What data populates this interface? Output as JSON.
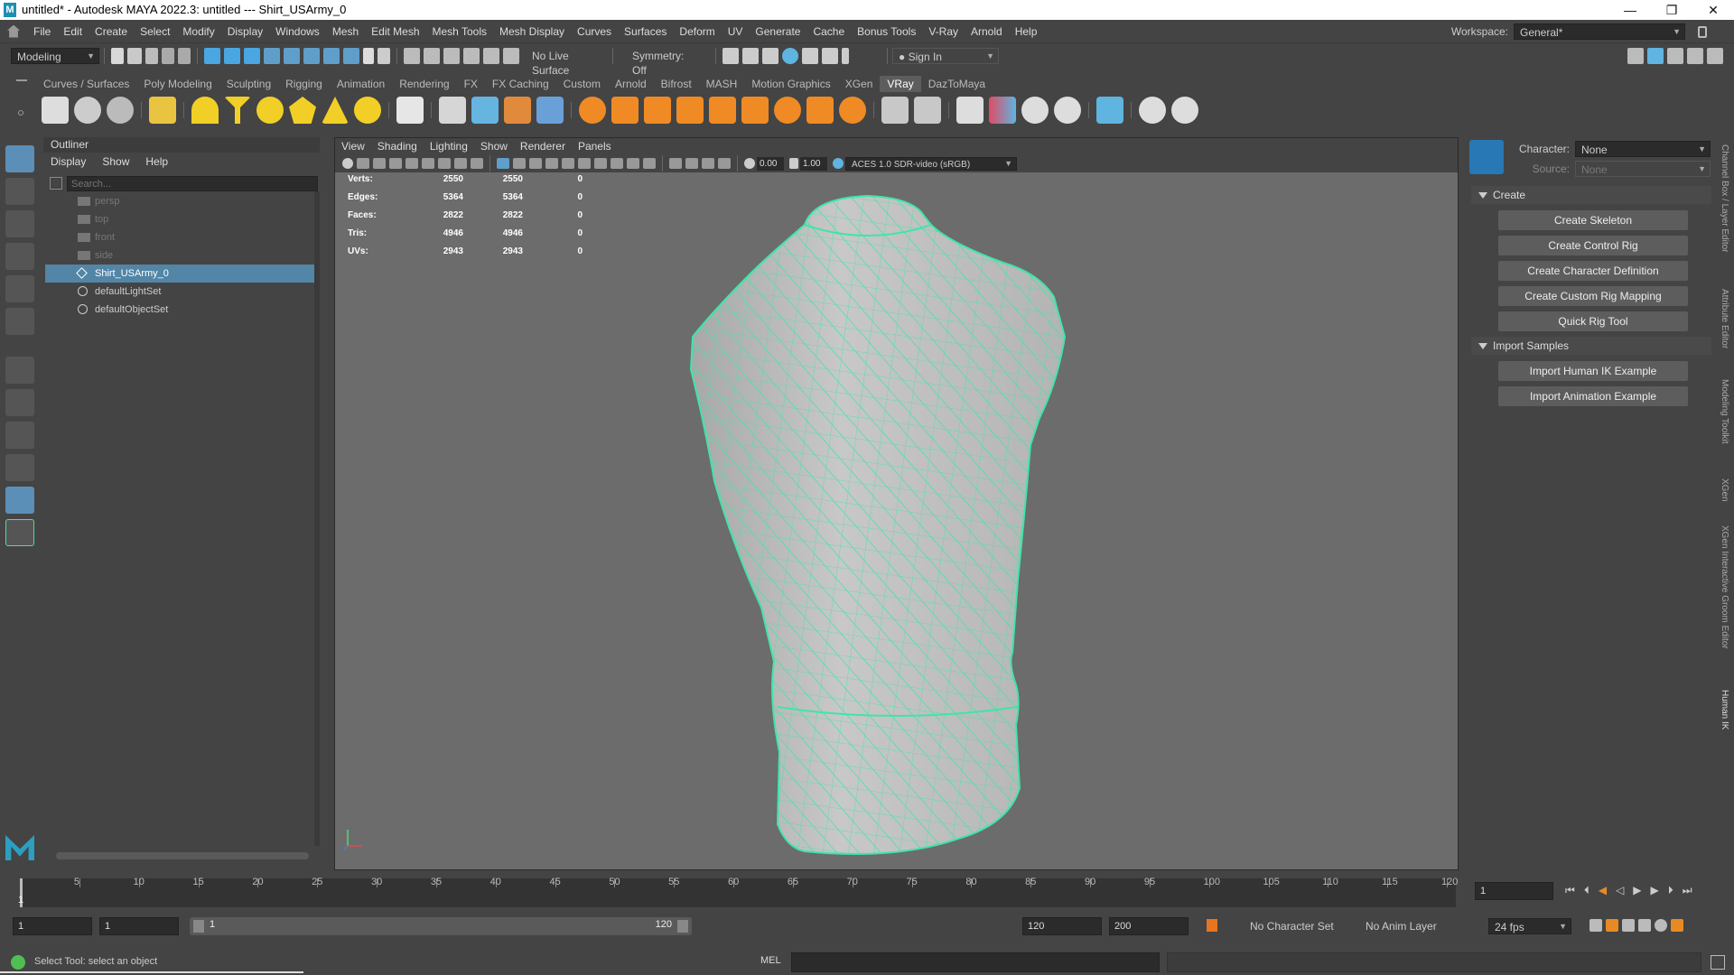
{
  "titlebar": {
    "title": "untitled* - Autodesk MAYA 2022.3: untitled  ---  Shirt_USArmy_0",
    "logo": "M",
    "min": "—",
    "max": "❐",
    "close": "✕"
  },
  "menubar": {
    "items": [
      "File",
      "Edit",
      "Create",
      "Select",
      "Modify",
      "Display",
      "Windows",
      "Mesh",
      "Edit Mesh",
      "Mesh Tools",
      "Mesh Display",
      "Curves",
      "Surfaces",
      "Deform",
      "UV",
      "Generate",
      "Cache",
      "Bonus Tools",
      "V-Ray",
      "Arnold",
      "Help"
    ],
    "workspace_label": "Workspace:",
    "workspace_value": "General*"
  },
  "statusline": {
    "mode": "Modeling",
    "live_surface": "No Live Surface",
    "symmetry": "Symmetry: Off",
    "sign_in": "Sign In"
  },
  "shelf": {
    "tabs": [
      "Curves / Surfaces",
      "Poly Modeling",
      "Sculpting",
      "Rigging",
      "Animation",
      "Rendering",
      "FX",
      "FX Caching",
      "Custom",
      "Arnold",
      "Bifrost",
      "MASH",
      "Motion Graphics",
      "XGen",
      "VRay",
      "DazToMaya"
    ],
    "active_tab": "VRay"
  },
  "outliner": {
    "title": "Outliner",
    "menu": [
      "Display",
      "Show",
      "Help"
    ],
    "search_placeholder": "Search...",
    "items": [
      {
        "label": "persp",
        "state": "dim",
        "icon": "camera-icon"
      },
      {
        "label": "top",
        "state": "dim",
        "icon": "camera-icon"
      },
      {
        "label": "front",
        "state": "dim",
        "icon": "camera-icon"
      },
      {
        "label": "side",
        "state": "dim",
        "icon": "camera-icon"
      },
      {
        "label": "Shirt_USArmy_0",
        "state": "selected",
        "icon": "mesh-icon"
      },
      {
        "label": "defaultLightSet",
        "state": "normal",
        "icon": "set-icon"
      },
      {
        "label": "defaultObjectSet",
        "state": "normal",
        "icon": "set-icon"
      }
    ]
  },
  "viewport": {
    "menu": [
      "View",
      "Shading",
      "Lighting",
      "Show",
      "Renderer",
      "Panels"
    ],
    "exposure": "0.00",
    "gamma": "1.00",
    "color_space": "ACES 1.0 SDR-video (sRGB)",
    "hud": [
      {
        "label": "Verts:",
        "a": "2550",
        "b": "2550",
        "c": "0"
      },
      {
        "label": "Edges:",
        "a": "5364",
        "b": "5364",
        "c": "0"
      },
      {
        "label": "Faces:",
        "a": "2822",
        "b": "2822",
        "c": "0"
      },
      {
        "label": "Tris:",
        "a": "4946",
        "b": "4946",
        "c": "0"
      },
      {
        "label": "UVs:",
        "a": "2943",
        "b": "2943",
        "c": "0"
      }
    ],
    "wire_color": "#3fe5a7"
  },
  "humanik": {
    "character_label": "Character:",
    "character_value": "None",
    "source_label": "Source:",
    "source_value": "None",
    "create_section": "Create",
    "buttons": [
      "Create Skeleton",
      "Create Control Rig",
      "Create Character Definition",
      "Create Custom Rig Mapping",
      "Quick Rig Tool"
    ],
    "import_section": "Import Samples",
    "import_buttons": [
      "Import Human IK Example",
      "Import Animation Example"
    ]
  },
  "sidetabs": [
    "Channel Box / Layer Editor",
    "Attribute Editor",
    "Modeling Toolkit",
    "XGen",
    "XGen Interactive Groom Editor",
    "Human IK"
  ],
  "timeline": {
    "ticks": [
      "5",
      "10",
      "15",
      "20",
      "25",
      "30",
      "35",
      "40",
      "45",
      "50",
      "55",
      "60",
      "65",
      "70",
      "75",
      "80",
      "85",
      "90",
      "95",
      "100",
      "105",
      "110",
      "115",
      "120"
    ],
    "current_marker": "1",
    "current_frame": "1"
  },
  "range": {
    "start": "1",
    "playback_start": "1",
    "slider_start": "1",
    "slider_end": "120",
    "playback_end": "120",
    "end": "200",
    "char_set": "No Character Set",
    "anim_layer": "No Anim Layer",
    "fps": "24 fps"
  },
  "cmdline": {
    "help": "Select Tool: select an object",
    "lang": "MEL"
  }
}
